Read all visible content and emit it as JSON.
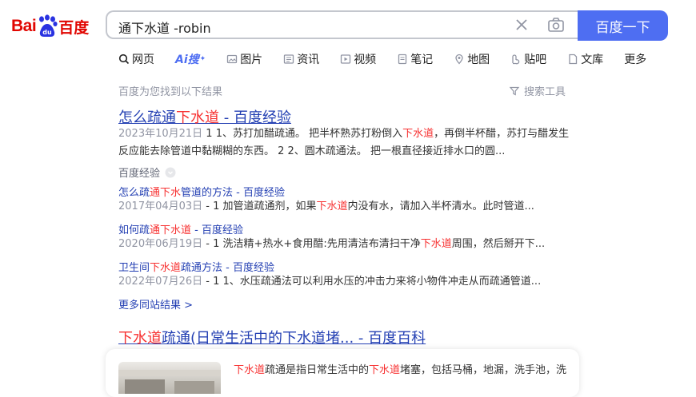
{
  "logo": {
    "text_en": "Bai",
    "text_cn": "百度"
  },
  "search": {
    "query": "通下水道 -robin",
    "button_label": "百度一下"
  },
  "tabs": [
    {
      "label": "网页"
    },
    {
      "label": "Ai搜"
    },
    {
      "label": "图片"
    },
    {
      "label": "资讯"
    },
    {
      "label": "视频"
    },
    {
      "label": "笔记"
    },
    {
      "label": "地图"
    },
    {
      "label": "贴吧"
    },
    {
      "label": "文库"
    },
    {
      "label": "更多"
    }
  ],
  "meta": {
    "found": "百度为您找到以下结果",
    "tools": "搜索工具"
  },
  "result1": {
    "title_a": "怎么疏通",
    "title_hl": "下水道",
    "title_b": " - 百度经验",
    "line1_date": "2023年10月21日",
    "line1_a": " 1 1、苏打加醋疏通。 把半杯熟苏打粉倒入",
    "line1_hl": "下水道",
    "line1_b": "，再倒半杯醋，苏打与醋发生",
    "line2": "反应能去除管道中黏糊糊的东西。 2 2、圆木疏通法。 把一根直径接近排水口的圆...",
    "source": "百度经验",
    "subs": [
      {
        "t_a": "怎么疏",
        "t_hl": "通下水",
        "t_b": "管道的方法 - 百度经验",
        "date": "2017年04月03日",
        "s_a": " - 1 加管道疏通剂，如果",
        "s_hl": "下水道",
        "s_b": "内没有水，请加入半杯清水。此时管道..."
      },
      {
        "t_a": "如何疏",
        "t_hl": "通下水道",
        "t_b": " - 百度经验",
        "date": "2020年06月19日",
        "s_a": " - 1 洗洁精+热水+食用醋:先用清洁布清扫干净",
        "s_hl": "下水道",
        "s_b": "周围，然后掰开下..."
      },
      {
        "t_a": "卫生间",
        "t_hl": "下水道",
        "t_b": "疏通方法 - 百度经验",
        "date": "2022年07月26日",
        "s_a": " - 1 1、水压疏通法可以利用水压的冲击力来将小物件冲走从而疏通管道...",
        "s_hl": "",
        "s_b": ""
      }
    ],
    "more": "更多同站结果 >"
  },
  "result2": {
    "title_hl": "下水道",
    "title_b": "疏通(日常生活中的下水道堵... - 百度百科",
    "snip_hl1": "下水道",
    "snip_a": "疏通是指日常生活中的",
    "snip_hl2": "下水道",
    "snip_b": "堵塞，包括马桶，地漏，洗手池，洗"
  },
  "colors": {
    "accent": "#4e6ef2",
    "brand_red": "#e10601",
    "link": "#2440b3",
    "highlight": "#f73131"
  }
}
